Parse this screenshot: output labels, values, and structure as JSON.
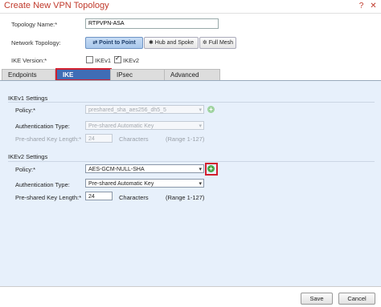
{
  "dialog": {
    "title": "Create New VPN Topology",
    "icons": [
      "help-icon",
      "close-icon"
    ]
  },
  "topology_name": {
    "label": "Topology Name:*",
    "value": "RTPVPN-ASA"
  },
  "network_topology": {
    "label": "Network Topology:",
    "options": [
      {
        "label": "Point to Point",
        "icon": "⇄",
        "selected": true
      },
      {
        "label": "Hub and Spoke",
        "icon": "✱",
        "selected": false
      },
      {
        "label": "Full Mesh",
        "icon": "✲",
        "selected": false
      }
    ]
  },
  "ike_version": {
    "label": "IKE Version:*",
    "ikev1_label": "IKEv1",
    "ikev1_checked": false,
    "ikev2_label": "IKEv2",
    "ikev2_checked": true
  },
  "tabs": [
    {
      "label": "Endpoints",
      "active": false
    },
    {
      "label": "IKE",
      "active": true
    },
    {
      "label": "IPsec",
      "active": false
    },
    {
      "label": "Advanced",
      "active": false
    }
  ],
  "ikev1": {
    "heading": "IKEv1 Settings",
    "policy_label": "Policy:*",
    "policy_value": "preshared_sha_aes256_dh5_5",
    "auth_label": "Authentication Type:",
    "auth_value": "Pre-shared Automatic Key",
    "key_len_label": "Pre-shared Key Length:*",
    "key_len_value": "24",
    "chars_label": "Characters",
    "range_label": "(Range 1-127)"
  },
  "ikev2": {
    "heading": "IKEv2 Settings",
    "policy_label": "Policy:*",
    "policy_value": "AES-GCM-NULL-SHA",
    "auth_label": "Authentication Type:",
    "auth_value": "Pre-shared Automatic Key",
    "key_len_label": "Pre-shared Key Length:*",
    "key_len_value": "24",
    "chars_label": "Characters",
    "range_label": "(Range 1-127)"
  },
  "footer": {
    "save_label": "Save",
    "cancel_label": "Cancel"
  },
  "colors": {
    "title": "#c0392b",
    "active_tab": "#3f6db6",
    "highlight": "#d21f2f",
    "panel_bg": "#e7f0fb"
  }
}
